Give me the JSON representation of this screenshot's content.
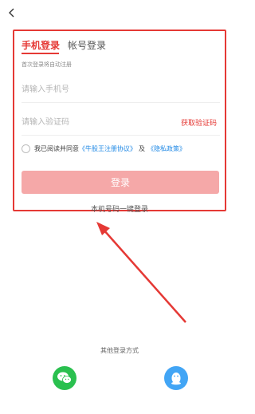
{
  "login": {
    "tabs": {
      "phone": "手机登录",
      "account": "帐号登录"
    },
    "hint": "首次登录将自动注册",
    "phone_placeholder": "请输入手机号",
    "code_placeholder": "请输入验证码",
    "get_code": "获取验证码",
    "agreement": {
      "prefix": "我已阅读并同意",
      "user_agreement": "《牛股王注册协议》",
      "and": "及",
      "privacy": "《隐私政策》"
    },
    "submit": "登录",
    "one_key_login": "本机号码一键登录"
  },
  "other_login": {
    "label": "其他登录方式",
    "options": [
      "wechat-icon",
      "qq-icon"
    ]
  },
  "colors": {
    "accent": "#e53935",
    "button_disabled": "#f5a8a8",
    "link": "#1e88e5",
    "wechat": "#2ac04f",
    "qq": "#42a5f5"
  }
}
